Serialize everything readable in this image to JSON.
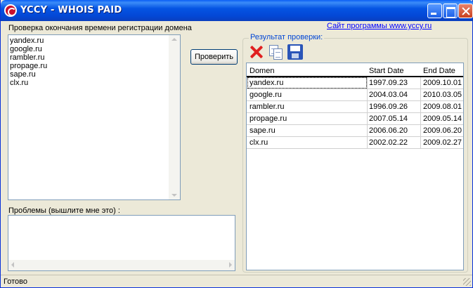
{
  "window": {
    "title": "YCCY - WHOIS PAID",
    "accent": "#0054e3"
  },
  "left": {
    "domains_label": "Проверка окончания времени регистрации домена",
    "domains": [
      "yandex.ru",
      "google.ru",
      "rambler.ru",
      "propage.ru",
      "sape.ru",
      "clx.ru"
    ],
    "problems_label": "Проблемы (вышлите мне это) :",
    "problems_value": ""
  },
  "check_button": "Проверить",
  "right": {
    "site_link": "Сайт программы www.yccy.ru",
    "group_title": "Результат проверки:",
    "toolbar": [
      "delete-icon",
      "copy-icon",
      "save-icon"
    ],
    "columns": [
      "Domen",
      "Start Date",
      "End Date"
    ],
    "rows": [
      {
        "domain": "yandex.ru",
        "start": "1997.09.23",
        "end": "2009.10.01"
      },
      {
        "domain": "google.ru",
        "start": "2004.03.04",
        "end": "2010.03.05"
      },
      {
        "domain": "rambler.ru",
        "start": "1996.09.26",
        "end": "2009.08.01"
      },
      {
        "domain": "propage.ru",
        "start": "2007.05.14",
        "end": "2009.05.14"
      },
      {
        "domain": "sape.ru",
        "start": "2006.06.20",
        "end": "2009.06.20"
      },
      {
        "domain": "clx.ru",
        "start": "2002.02.22",
        "end": "2009.02.27"
      }
    ]
  },
  "status": "Готово"
}
